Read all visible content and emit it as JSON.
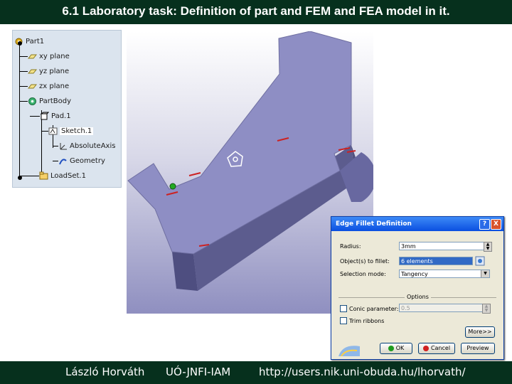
{
  "title": "6.1 Laboratory task: Definition of part and FEM and FEA model in it.",
  "tree": {
    "part": "Part1",
    "xy_plane": "xy plane",
    "yz_plane": "yz plane",
    "zx_plane": "zx plane",
    "part_body": "PartBody",
    "pad": "Pad.1",
    "sketch": "Sketch.1",
    "abs_axis": "AbsoluteAxis",
    "geometry": "Geometry",
    "loadset": "LoadSet.1"
  },
  "dialog": {
    "title": "Edge Fillet Definition",
    "help": "?",
    "close": "X",
    "radius_label": "Radius:",
    "radius_value": "3mm",
    "objects_label": "Object(s) to fillet:",
    "objects_value": "6 elements",
    "mode_label": "Selection mode:",
    "mode_value": "Tangency",
    "options_label": "Options",
    "conic_label": "Conic parameter:",
    "conic_value": "0.5",
    "trim_label": "Trim ribbons",
    "more_label": "More>>",
    "ok_label": "OK",
    "cancel_label": "Cancel",
    "preview_label": "Preview"
  },
  "footer": {
    "author": "László Horváth",
    "institute": "UÓ-JNFI-IAM",
    "url": "http://users.nik.uni-obuda.hu/lhorvath/"
  },
  "colors": {
    "banner": "#06301d",
    "part_face": "#8e8ec4",
    "part_side": "#5c5c8e",
    "edge_marker": "#cc2222"
  }
}
